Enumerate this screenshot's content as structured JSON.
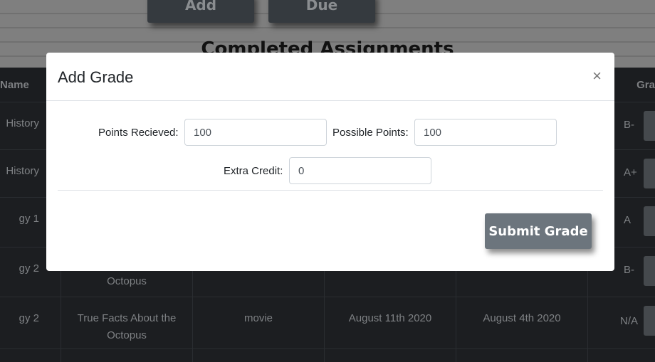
{
  "page": {
    "buttons": [
      "Add",
      "Due"
    ],
    "heading": "Completed Assignments"
  },
  "table": {
    "headers": [
      "Name",
      "Gra"
    ],
    "rows": [
      {
        "course": "History",
        "title": "",
        "type": "",
        "due": "",
        "assigned": "",
        "grade": "B-"
      },
      {
        "course": "History",
        "title": "",
        "type": "",
        "due": "",
        "assigned": "",
        "grade": "A+"
      },
      {
        "course": "gy 1",
        "title": "",
        "type": "",
        "due": "",
        "assigned": "",
        "grade": "A"
      },
      {
        "course": "gy 2",
        "title": "Octopus",
        "type": "",
        "due": "",
        "assigned": "",
        "grade": "B-"
      },
      {
        "course": "gy 2",
        "title": "True Facts About the Octopus",
        "type": "movie",
        "due": "August 11th 2020",
        "assigned": "August 4th 2020",
        "grade": "N/A"
      }
    ]
  },
  "modal": {
    "title": "Add Grade",
    "close": "×",
    "points_received_label": "Points Recieved:",
    "points_received_value": "100",
    "possible_points_label": "Possible Points:",
    "possible_points_value": "100",
    "extra_credit_label": "Extra Credit:",
    "extra_credit_value": "0",
    "submit": "Submit Grade"
  }
}
